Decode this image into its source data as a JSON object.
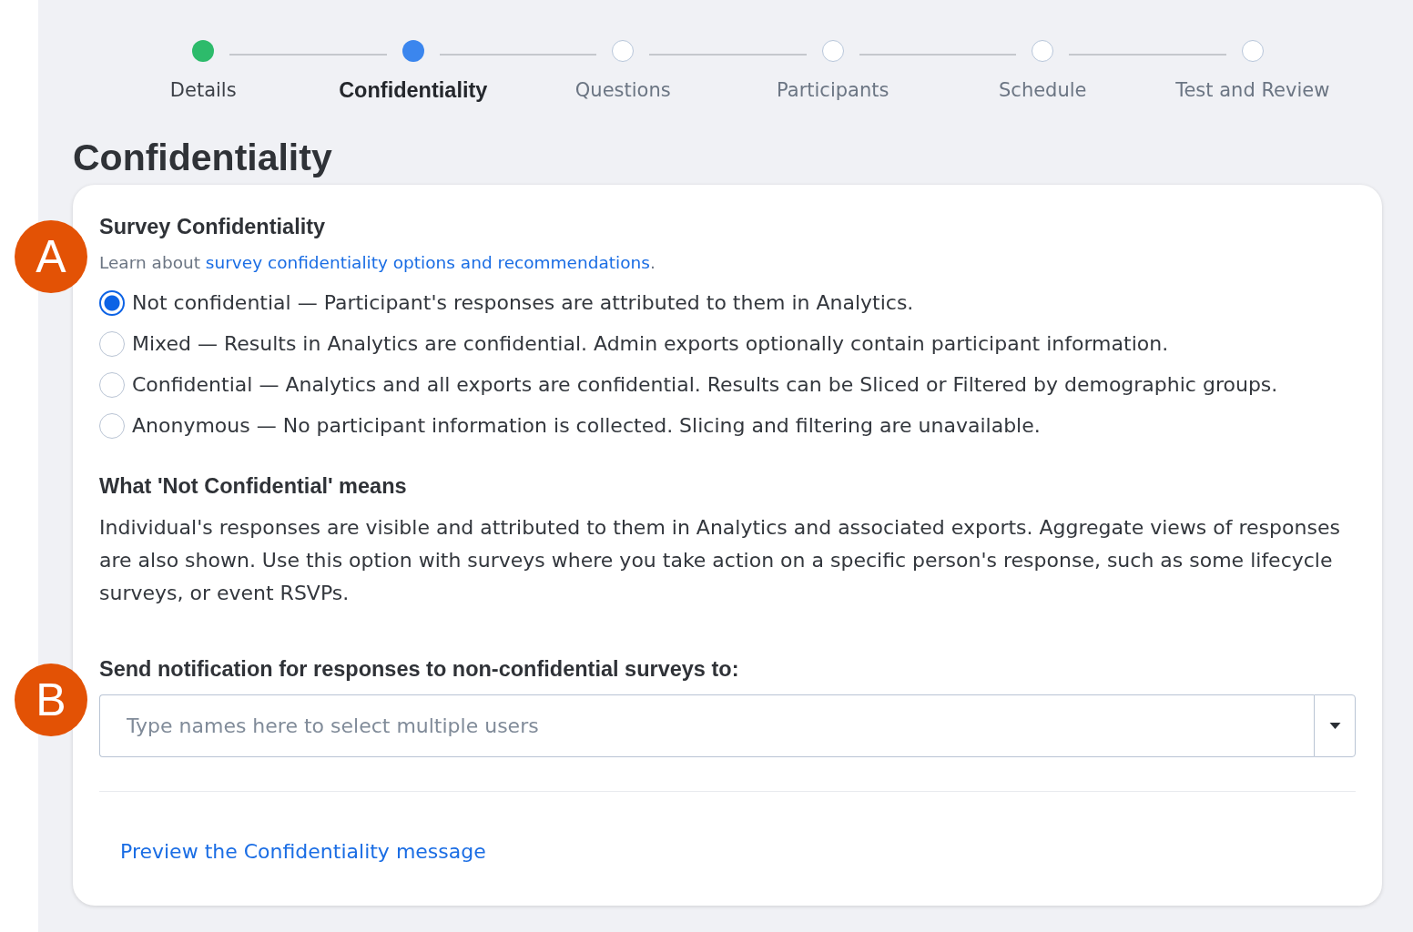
{
  "steps": [
    {
      "label": "Details",
      "completed": true,
      "selected": false
    },
    {
      "label": "Confidentiality",
      "completed": false,
      "selected": true
    },
    {
      "label": "Questions",
      "completed": false,
      "selected": false
    },
    {
      "label": "Participants",
      "completed": false,
      "selected": false
    },
    {
      "label": "Schedule",
      "completed": false,
      "selected": false
    },
    {
      "label": "Test and Review",
      "completed": false,
      "selected": false
    }
  ],
  "page_title": "Confidentiality",
  "survey_confidentiality": {
    "marker": "A",
    "heading": "Survey Confidentiality",
    "learn_more": {
      "text_before": "Learn about",
      "link": "survey confidentiality options and recommendations",
      "text_after": "."
    },
    "options": [
      {
        "label": "Not confidential — Participant's responses are attributed to them in Analytics.",
        "selected": true
      },
      {
        "label": "Mixed — Results in Analytics are confidential. Admin exports optionally contain participant information.",
        "selected": false
      },
      {
        "label": "Confidential — Analytics and all exports are confidential. Results can be Sliced or Filtered by demographic groups.",
        "selected": false
      },
      {
        "label": "Anonymous — No participant information is collected. Slicing and filtering are unavailable.",
        "selected": false
      }
    ]
  },
  "explanation": {
    "heading": "What 'Not Confidential' means",
    "body": "Individual's responses are visible and attributed to them in Analytics and associated exports. Aggregate views of responses are also shown. Use this option with surveys where you take action on a specific person's response, such as some lifecycle surveys, or event RSVPs."
  },
  "notification": {
    "marker": "B",
    "label": "Send notification for responses to non-confidential surveys to:",
    "placeholder": "Type names here to select multiple users"
  },
  "preview_link": "Preview the Confidentiality message"
}
